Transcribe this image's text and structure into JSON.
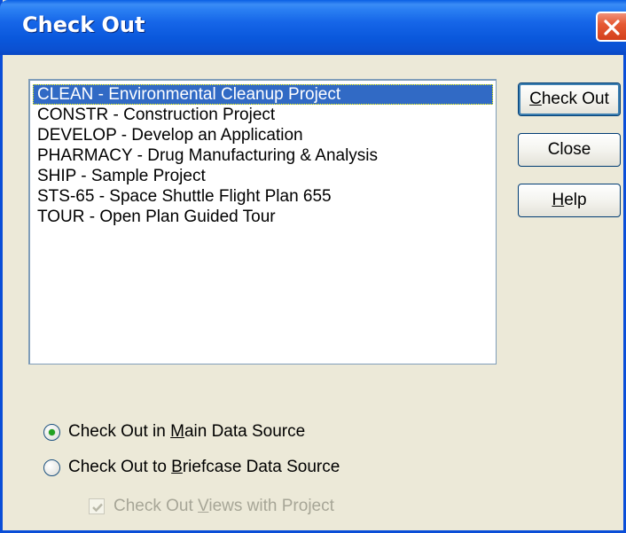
{
  "window": {
    "title": "Check Out"
  },
  "projects": [
    {
      "label": "CLEAN - Environmental Cleanup Project",
      "selected": true
    },
    {
      "label": "CONSTR - Construction Project",
      "selected": false
    },
    {
      "label": "DEVELOP - Develop an Application",
      "selected": false
    },
    {
      "label": "PHARMACY - Drug Manufacturing & Analysis",
      "selected": false
    },
    {
      "label": "SHIP - Sample Project",
      "selected": false
    },
    {
      "label": "STS-65 - Space Shuttle Flight Plan 655",
      "selected": false
    },
    {
      "label": "TOUR - Open Plan Guided Tour",
      "selected": false
    }
  ],
  "buttons": {
    "check_out": {
      "pre": "",
      "mnemonic": "C",
      "post": "heck Out"
    },
    "close": "Close",
    "help": {
      "pre": "",
      "mnemonic": "H",
      "post": "elp"
    }
  },
  "options": {
    "main": {
      "pre": "Check Out in ",
      "mnemonic": "M",
      "post": "ain Data Source",
      "checked": true
    },
    "briefcase": {
      "pre": "Check Out to ",
      "mnemonic": "B",
      "post": "riefcase Data Source",
      "checked": false
    },
    "views": {
      "pre": "Check Out ",
      "mnemonic": "V",
      "post": "iews with Project",
      "checked": true,
      "enabled": false
    }
  },
  "colors": {
    "titlebar": "#0a58dc",
    "selection": "#316ac5",
    "dialog_bg": "#ece9d8",
    "close_button": "#e65a34"
  },
  "icons": {
    "close": "close-x-icon",
    "radio_checked": "radio-dot",
    "checkbox_checked": "checkmark-icon"
  }
}
